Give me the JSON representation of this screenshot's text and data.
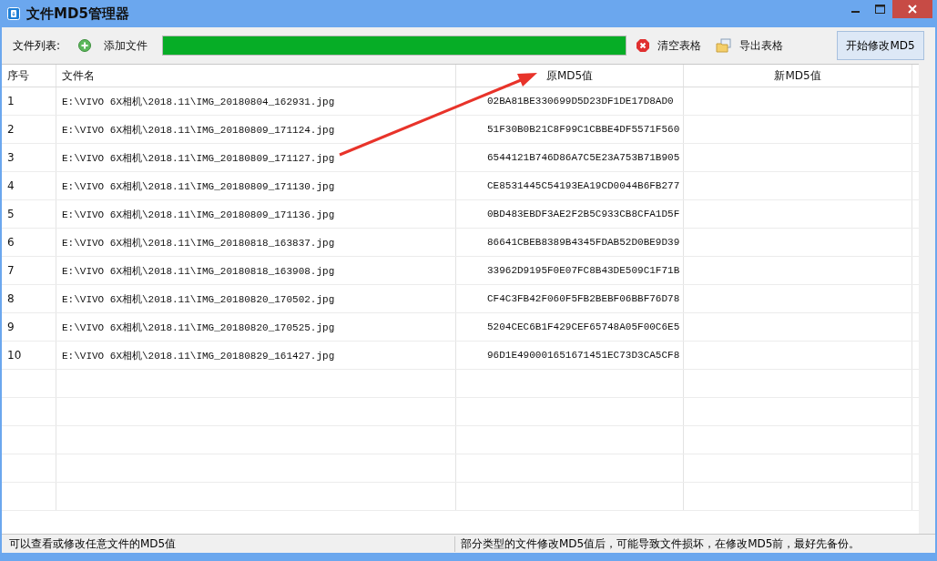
{
  "window": {
    "title": "文件MD5管理器"
  },
  "toolbar": {
    "label": "文件列表:",
    "add_button": "添加文件",
    "progress": {
      "level": 1
    },
    "clear_button": "清空表格",
    "export_button": "导出表格",
    "start_button": "开始修改MD5"
  },
  "table": {
    "columns": [
      "序号",
      "文件名",
      "原MD5值",
      "新MD5值"
    ],
    "rows": [
      {
        "index": "1",
        "file": "E:\\VIVO 6X相机\\2018.11\\IMG_20180804_162931.jpg",
        "old_md5": "02BA81BE330699D5D23DF1DE17D8AD0",
        "new_md5": ""
      },
      {
        "index": "2",
        "file": "E:\\VIVO 6X相机\\2018.11\\IMG_20180809_171124.jpg",
        "old_md5": "51F30B0B21C8F99C1CBBE4DF5571F560"
      },
      {
        "index": "3",
        "file": "E:\\VIVO 6X相机\\2018.11\\IMG_20180809_171127.jpg",
        "old_md5": "6544121B746D86A7C5E23A753B71B905"
      },
      {
        "index": "4",
        "file": "E:\\VIVO 6X相机\\2018.11\\IMG_20180809_171130.jpg",
        "old_md5": "CE8531445C54193EA19CD0044B6FB277"
      },
      {
        "index": "5",
        "file": "E:\\VIVO 6X相机\\2018.11\\IMG_20180809_171136.jpg",
        "old_md5": "0BD483EBDF3AE2F2B5C933CB8CFA1D5F"
      },
      {
        "index": "6",
        "file": "E:\\VIVO 6X相机\\2018.11\\IMG_20180818_163837.jpg",
        "old_md5": "86641CBEB8389B4345FDAB52D0BE9D39"
      },
      {
        "index": "7",
        "file": "E:\\VIVO 6X相机\\2018.11\\IMG_20180818_163908.jpg",
        "old_md5": "33962D9195F0E07FC8B43DE509C1F71B"
      },
      {
        "index": "8",
        "file": "E:\\VIVO 6X相机\\2018.11\\IMG_20180820_170502.jpg",
        "old_md5": "CF4C3FB42F060F5FB2BEBF06BBF76D78"
      },
      {
        "index": "9",
        "file": "E:\\VIVO 6X相机\\2018.11\\IMG_20180820_170525.jpg",
        "old_md5": "5204CEC6B1F429CEF65748A05F00C6E5"
      },
      {
        "index": "10",
        "file": "E:\\VIVO 6X相机\\2018.11\\IMG_20180829_161427.jpg",
        "old_md5": "96D1E490001651671451EC73D3CA5CF8"
      }
    ]
  },
  "status_bar": {
    "left": "可以查看或修改任意文件的MD5值",
    "right": "部分类型的文件修改MD5值后，可能导致文件损坏，在修改MD5前，最好先备份。"
  }
}
